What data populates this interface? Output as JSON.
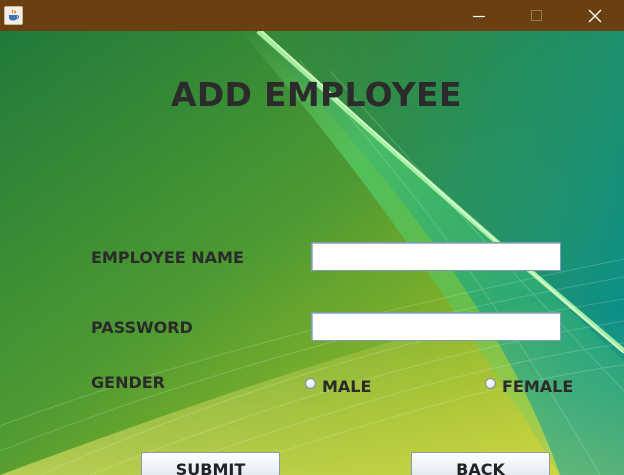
{
  "window": {
    "app_icon": "java-cup-icon",
    "controls": [
      "minimize-icon",
      "maximize-icon",
      "close-icon"
    ]
  },
  "form": {
    "title": "ADD EMPLOYEE",
    "employee_name_label": "EMPLOYEE NAME",
    "employee_name_value": "",
    "password_label": "PASSWORD",
    "password_value": "",
    "gender_label": "GENDER",
    "gender_options": [
      "MALE",
      "FEMALE"
    ],
    "gender_selected": null,
    "submit_label": "SUBMIT",
    "back_label": "BACK"
  },
  "colors": {
    "titlebar": "#6a3f12",
    "text": "#2a2a2a"
  }
}
